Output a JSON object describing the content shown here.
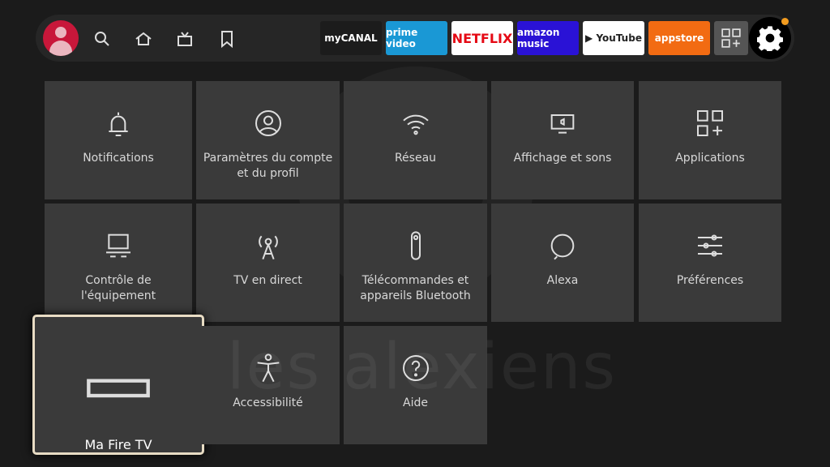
{
  "nav": {
    "icons": [
      "profile-avatar",
      "search-icon",
      "home-icon",
      "live-tv-icon",
      "bookmark-icon"
    ]
  },
  "apps": [
    {
      "label": "myCANAL",
      "bg": "#1c1c1c",
      "fg": "#ffffff"
    },
    {
      "label": "prime video",
      "bg": "#1a98d5",
      "fg": "#ffffff"
    },
    {
      "label": "NETFLIX",
      "bg": "#ffffff",
      "fg": "#e50914"
    },
    {
      "label": "amazon music",
      "bg": "#2a12d6",
      "fg": "#ffffff"
    },
    {
      "label": "▶ YouTube",
      "bg": "#ffffff",
      "fg": "#222222"
    },
    {
      "label": "appstore",
      "bg": "#f26b12",
      "fg": "#ffffff"
    }
  ],
  "settings_tiles": [
    {
      "label": "Notifications",
      "icon": "bell-icon"
    },
    {
      "label": "Paramètres du compte et du profil",
      "icon": "account-icon"
    },
    {
      "label": "Réseau",
      "icon": "wifi-icon"
    },
    {
      "label": "Affichage et sons",
      "icon": "display-sound-icon"
    },
    {
      "label": "Applications",
      "icon": "apps-icon"
    },
    {
      "label": "Contrôle de l'équipement",
      "icon": "equipment-icon"
    },
    {
      "label": "TV en direct",
      "icon": "antenna-icon"
    },
    {
      "label": "Télécommandes et appareils Bluetooth",
      "icon": "remote-icon"
    },
    {
      "label": "Alexa",
      "icon": "alexa-icon"
    },
    {
      "label": "Préférences",
      "icon": "sliders-icon"
    },
    {
      "label": "Ma Fire TV",
      "icon": "fire-tv-icon"
    },
    {
      "label": "Accessibilité",
      "icon": "accessibility-icon"
    },
    {
      "label": "Aide",
      "icon": "help-icon"
    }
  ],
  "focused": "Ma Fire TV",
  "watermark": "les alexiens",
  "colors": {
    "accent_focus": "#e8dcc4",
    "notification_dot": "#f39c1f",
    "avatar": "#c8173a"
  }
}
